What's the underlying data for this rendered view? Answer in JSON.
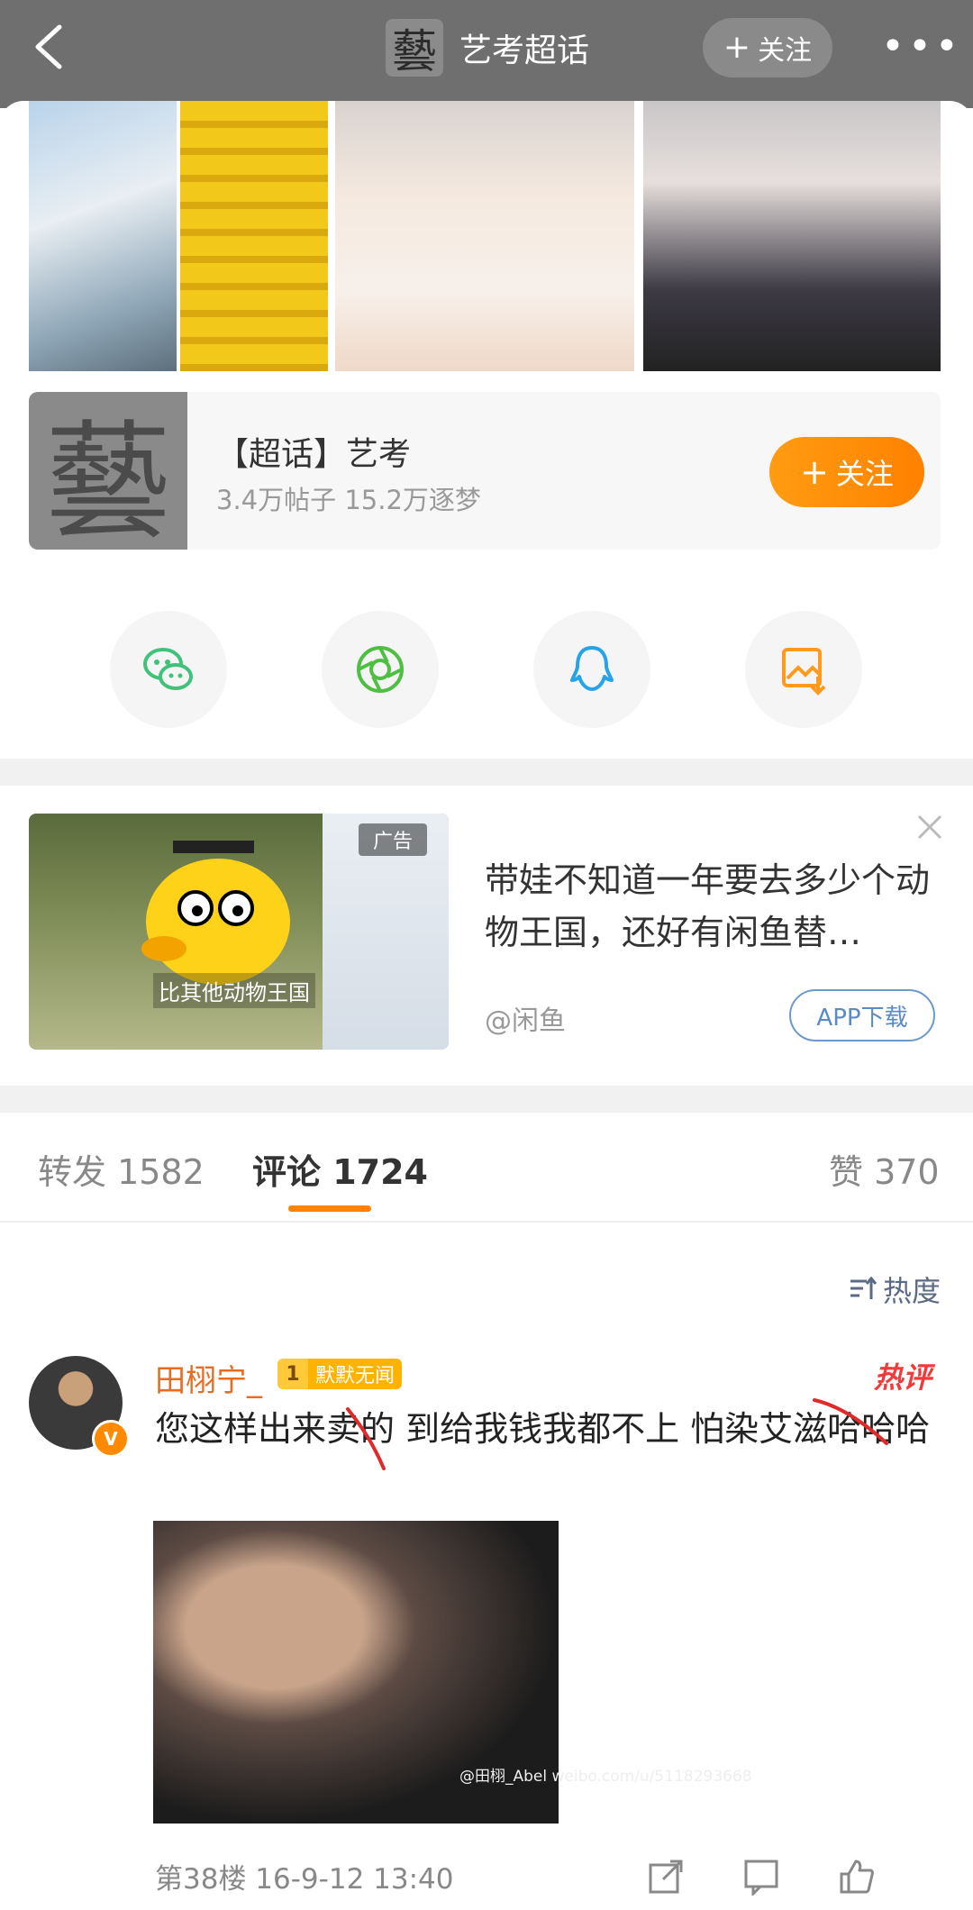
{
  "header": {
    "back_icon": "chevron-left-icon",
    "logo_char": "藝",
    "title": "艺考超话",
    "follow_label": "关注",
    "more_icon": "more-dots-icon"
  },
  "topic": {
    "logo_char": "藝",
    "name": "【超话】艺考",
    "meta": "3.4万帖子 15.2万逐梦",
    "follow_label": "关注"
  },
  "share_icons": [
    "wechat-icon",
    "moments-icon",
    "qq-icon",
    "save-image-icon"
  ],
  "ad": {
    "tag": "广告",
    "caption": "比其他动物王国",
    "text": "带娃不知道一年要去多少个动物王国，还好有闲鱼替…",
    "source": "@闲鱼",
    "button": "APP下载"
  },
  "tabs": {
    "repost": "转发 1582",
    "comment": "评论 1724",
    "like": "赞 370"
  },
  "sort": {
    "label": "热度"
  },
  "comment": {
    "username": "田栩宁_",
    "medal_level": "1",
    "medal_text": "默默无闻",
    "badge": "热评",
    "text": "您这样出来卖的 到给我钱我都不上 怕染艾滋哈哈哈",
    "image_watermark": "@田栩_Abel weibo.com/u/5118293668",
    "floor_meta": "第38楼 16-9-12 13:40"
  },
  "colors": {
    "accent": "#ff8200",
    "username": "#e86b1f",
    "hot": "#f23a3a",
    "link_blue": "#5a8bc4"
  }
}
